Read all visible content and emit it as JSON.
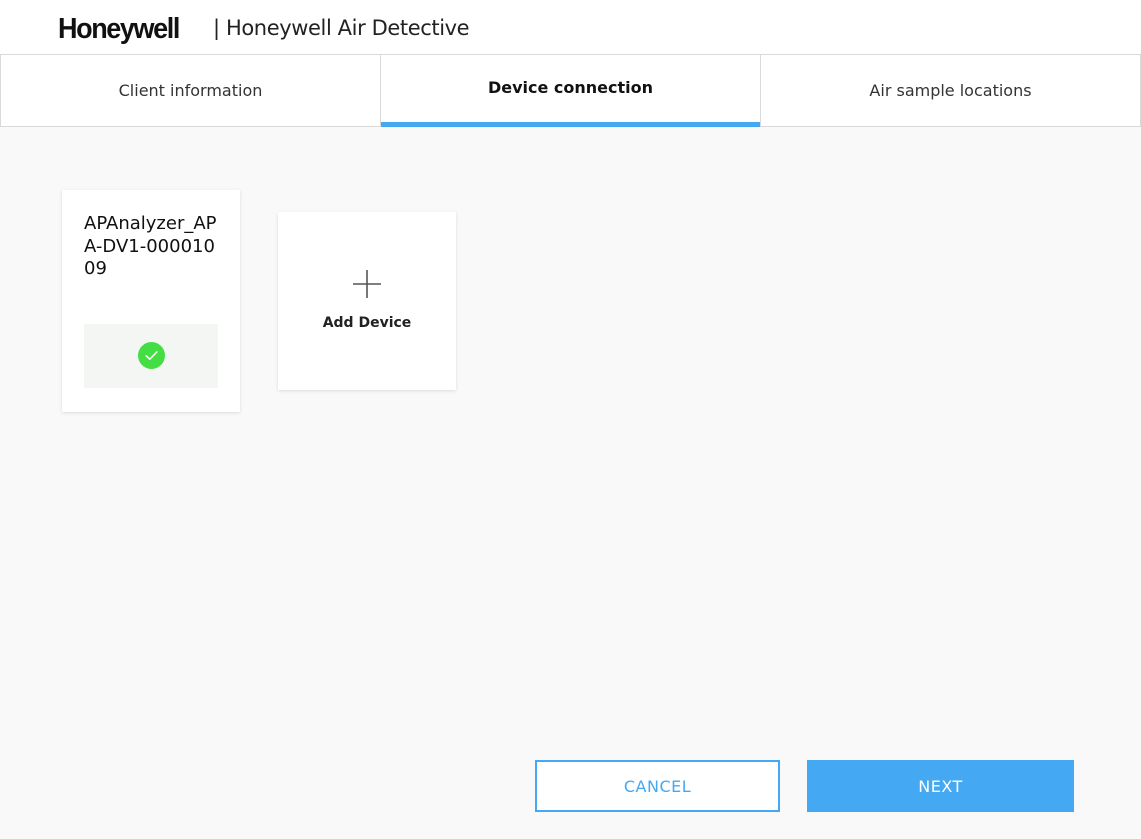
{
  "header": {
    "logo": "Honeywell",
    "app_title": "| Honeywell Air Detective"
  },
  "tabs": [
    {
      "label": "Client information",
      "active": false
    },
    {
      "label": "Device connection",
      "active": true
    },
    {
      "label": "Air sample locations",
      "active": false
    }
  ],
  "devices": [
    {
      "name": "APAnalyzer_APA-DV1-00001009",
      "status": "connected"
    }
  ],
  "add_device": {
    "label": "Add Device"
  },
  "footer": {
    "cancel_label": "CANCEL",
    "next_label": "NEXT"
  },
  "colors": {
    "accent": "#45a8f2",
    "status_connected": "#44dd44"
  },
  "icons": {
    "status": "check-circle-icon",
    "add": "plus-icon"
  }
}
